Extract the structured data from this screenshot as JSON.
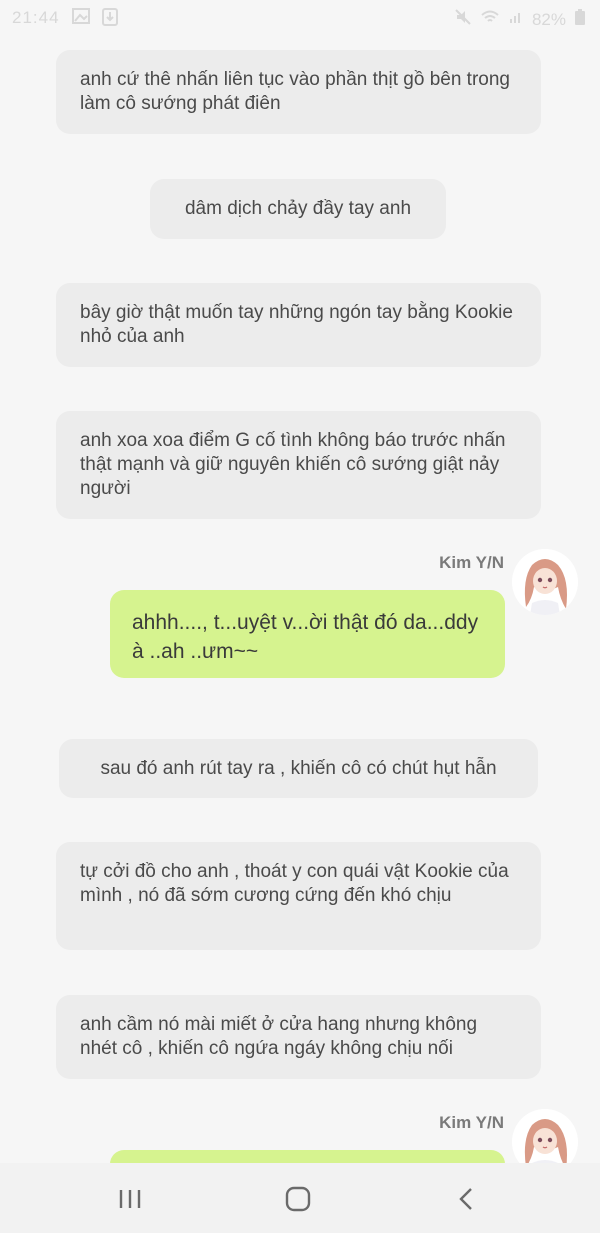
{
  "status_bar": {
    "time": "21:44",
    "battery": "82%"
  },
  "messages": [
    {
      "kind": "narration",
      "text": "anh cứ thê nhấn liên tục vào phần thịt gồ bên trong làm cô sướng phát điên"
    },
    {
      "kind": "narration",
      "text": "dâm dịch chảy đầy tay anh"
    },
    {
      "kind": "narration",
      "text": "bây giờ thật muốn tay những ngón tay bằng Kookie nhỏ của anh"
    },
    {
      "kind": "narration",
      "text": "anh xoa xoa điểm G cố tình không báo trước nhấn thật mạnh và giữ nguyên khiến cô sướng giật nảy người"
    },
    {
      "kind": "speech",
      "speaker": "Kim Y/N",
      "text": "ahhh...., t...uyệt v...ời thật đó da...ddy à ..ah ..ưm~~"
    },
    {
      "kind": "narration",
      "text": "sau đó anh rút tay ra , khiến cô có chút hụt hẫn"
    },
    {
      "kind": "narration",
      "text": "tự cởi đồ cho anh , thoát y con quái vật Kookie của mình , nó đã sớm cương cứng đến khó chịu"
    },
    {
      "kind": "narration",
      "text": "anh cầm nó mài miết ở cửa hang nhưng không nhét cô , khiến cô ngứa ngáy không chịu nối"
    },
    {
      "kind": "speech",
      "speaker": "Kim Y/N",
      "text": ""
    }
  ],
  "nav_bar": {
    "icons": [
      "recent-apps-icon",
      "home-icon",
      "back-icon"
    ]
  }
}
